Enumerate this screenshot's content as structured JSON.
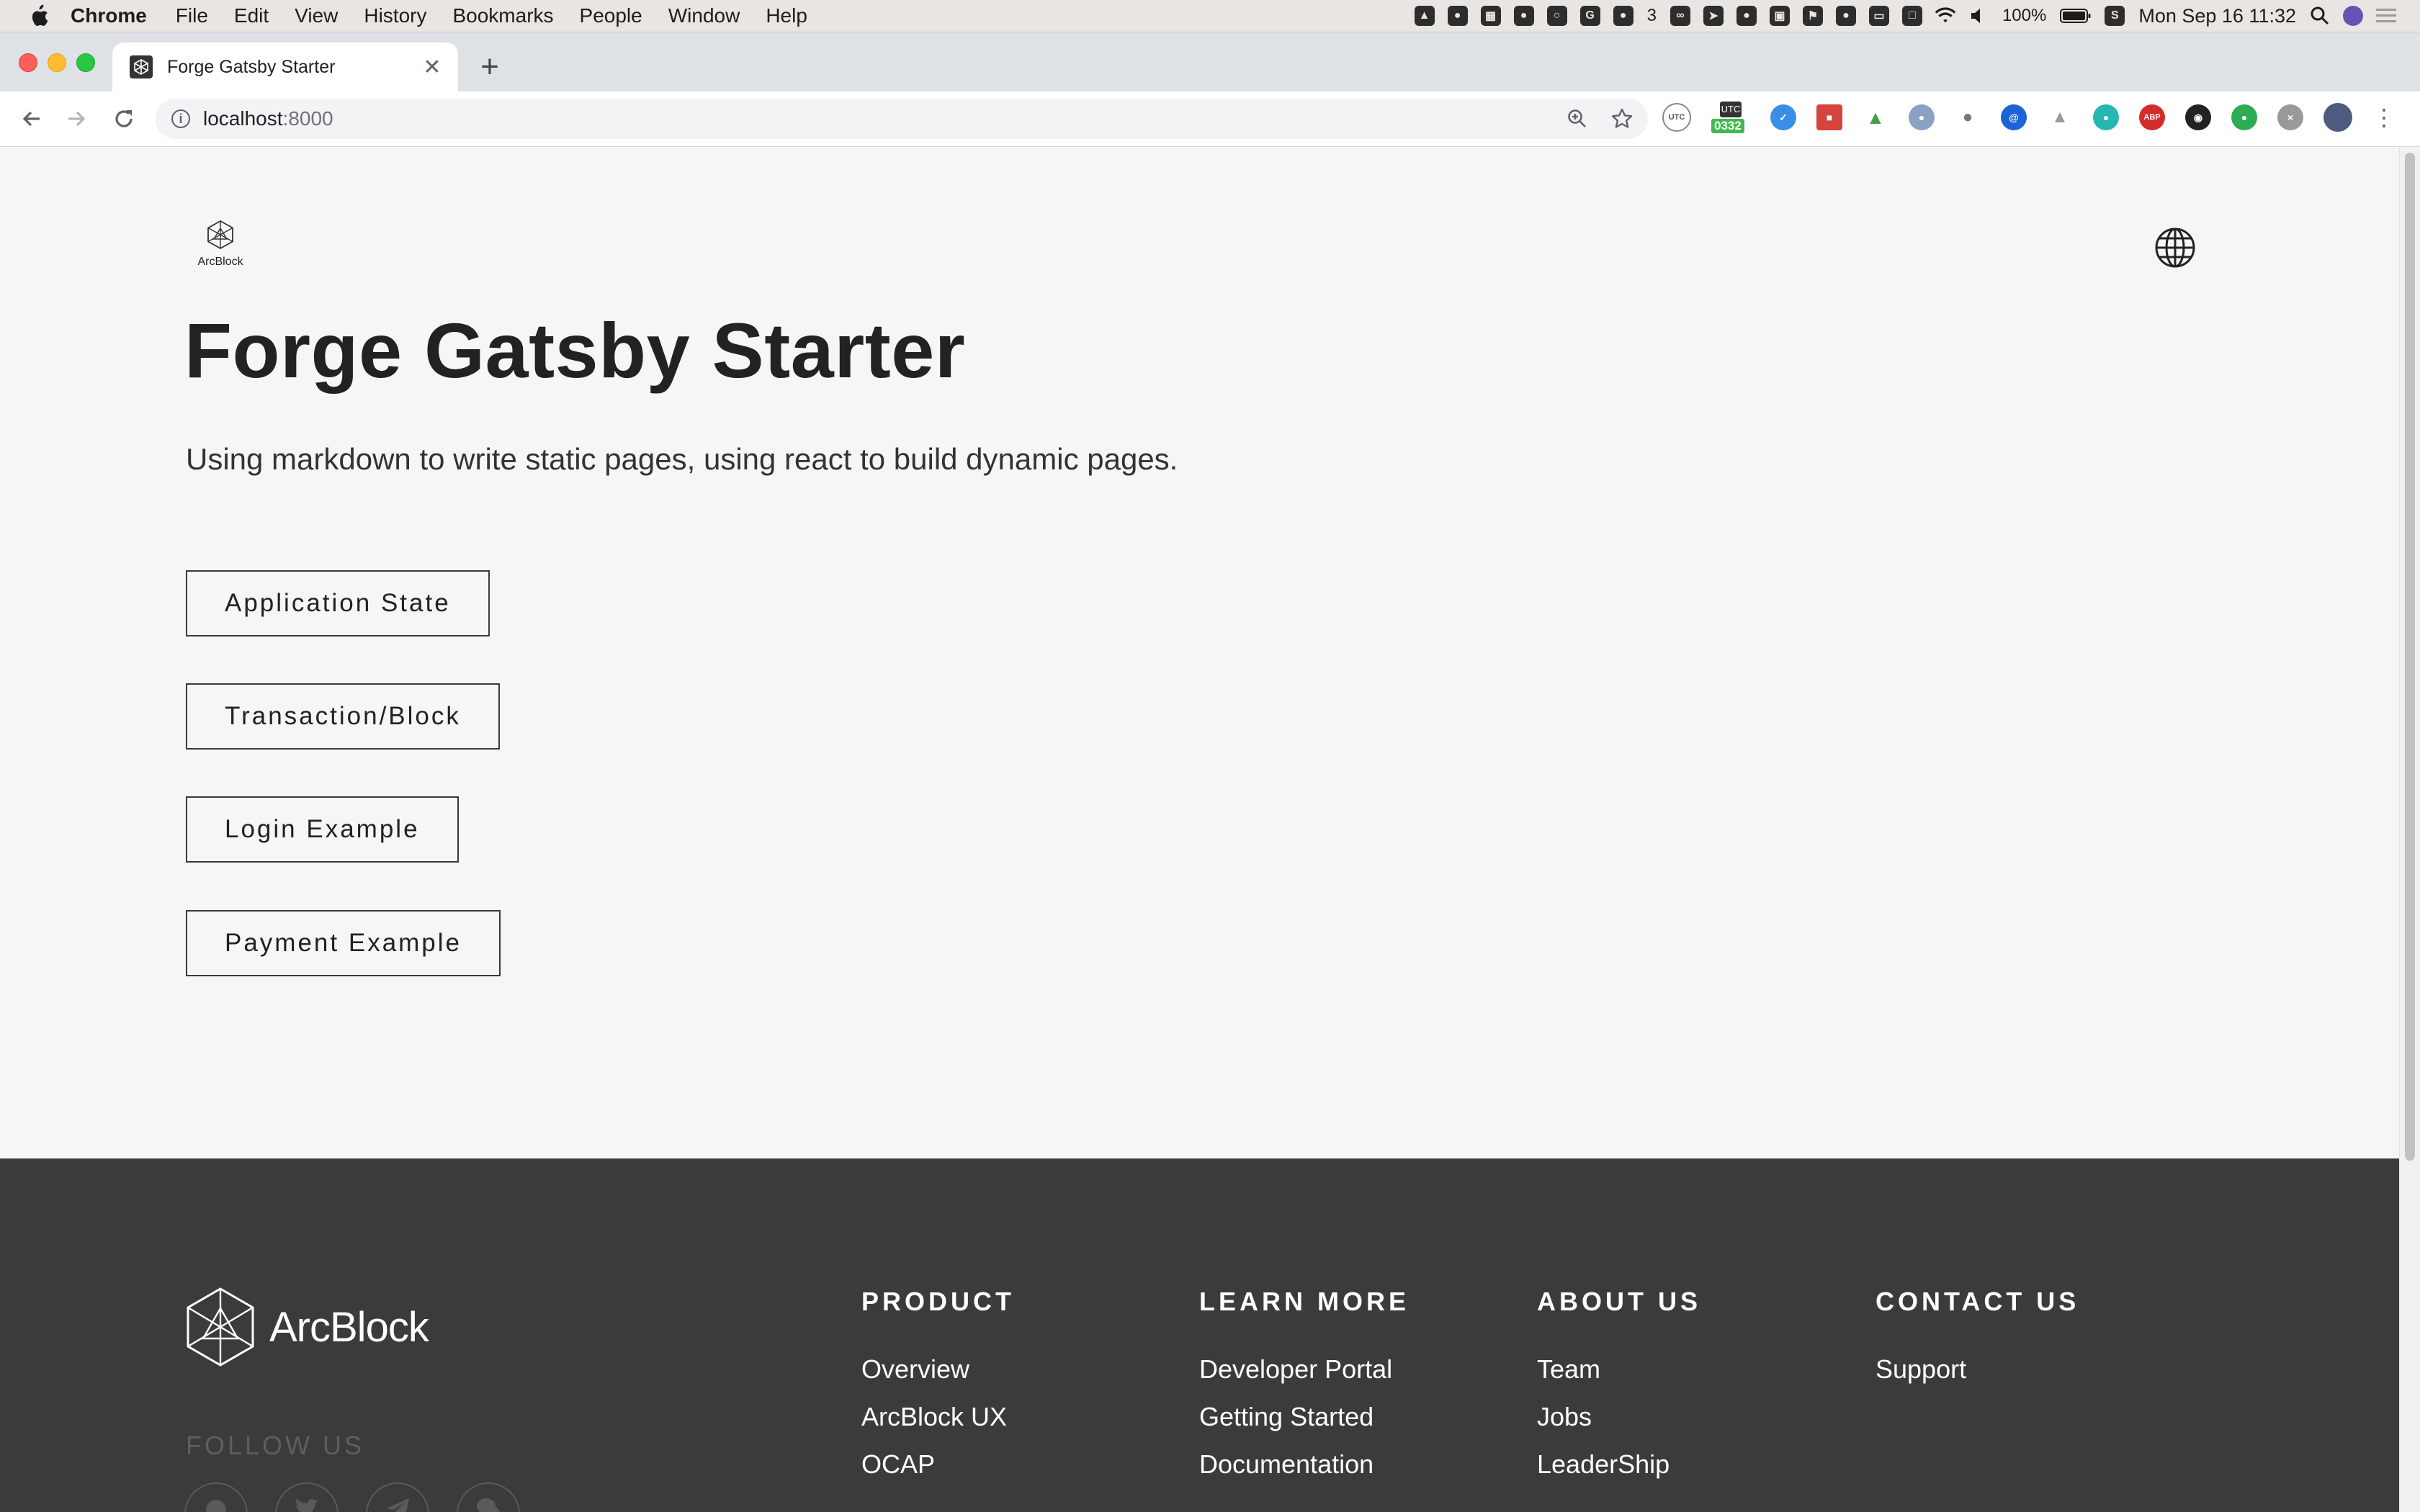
{
  "menubar": {
    "app_name": "Chrome",
    "items": [
      "File",
      "Edit",
      "View",
      "History",
      "Bookmarks",
      "People",
      "Window",
      "Help"
    ],
    "notification_count": "3",
    "battery": "100%",
    "datetime": "Mon Sep 16  11:32"
  },
  "browser": {
    "tab_title": "Forge Gatsby Starter",
    "url_host": "localhost",
    "url_port": ":8000",
    "extensions": {
      "utc_label": "UTC",
      "time_badge": "0332",
      "abp_label": "ABP"
    }
  },
  "page": {
    "logo_label": "ArcBlock",
    "title": "Forge Gatsby Starter",
    "subtitle": "Using markdown to write static pages, using react to build dynamic pages.",
    "buttons": [
      "Application State",
      "Transaction/Block",
      "Login Example",
      "Payment Example"
    ]
  },
  "footer": {
    "brand": "ArcBlock",
    "follow_label": "FOLLOW US",
    "columns": [
      {
        "title": "PRODUCT",
        "links": [
          "Overview",
          "ArcBlock UX",
          "OCAP"
        ]
      },
      {
        "title": "LEARN MORE",
        "links": [
          "Developer Portal",
          "Getting Started",
          "Documentation"
        ]
      },
      {
        "title": "ABOUT US",
        "links": [
          "Team",
          "Jobs",
          "LeaderShip"
        ]
      },
      {
        "title": "CONTACT US",
        "links": [
          "Support"
        ]
      }
    ]
  },
  "colors": {
    "page_bg": "#f5f6f5",
    "footer_bg": "#3b3b3b",
    "text_dark": "#222222",
    "tab_strip": "#dee1e6"
  },
  "icons": [
    "apple-icon",
    "wifi-icon",
    "volume-icon",
    "battery-icon",
    "search-icon",
    "back-arrow-icon",
    "forward-arrow-icon",
    "reload-icon",
    "info-icon",
    "zoom-icon",
    "star-icon",
    "globe-icon",
    "github-icon",
    "twitter-icon",
    "telegram-icon",
    "wechat-icon"
  ]
}
